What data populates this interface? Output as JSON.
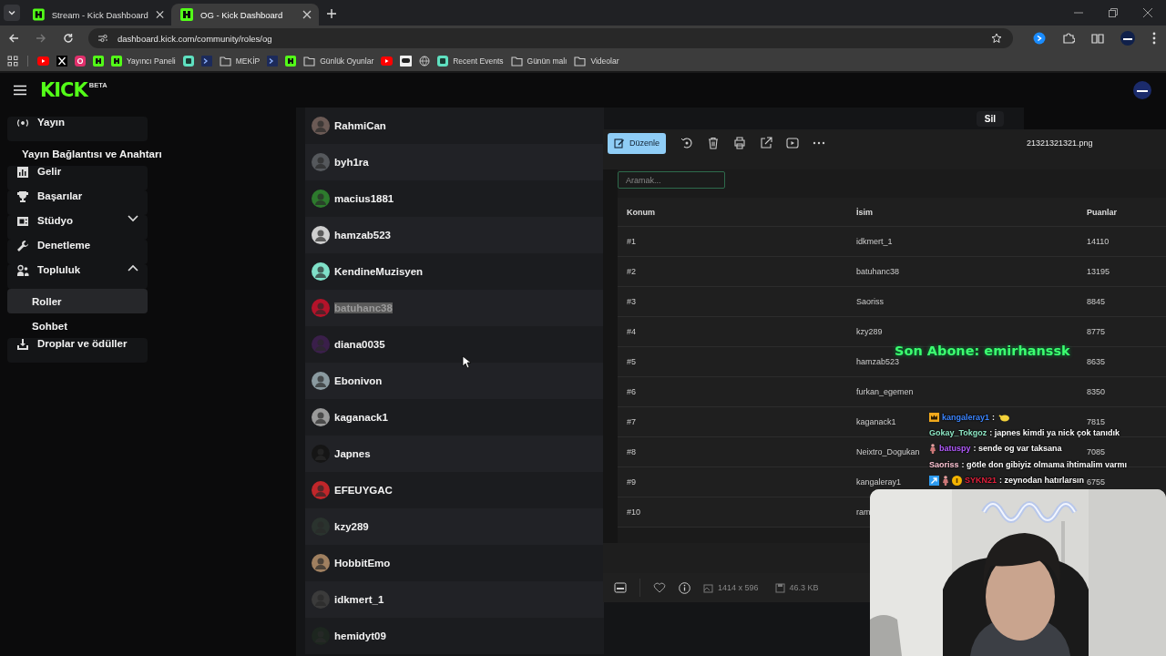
{
  "browser": {
    "tabs": [
      {
        "title": "Stream - Kick Dashboard",
        "selected": false
      },
      {
        "title": "OG - Kick Dashboard",
        "selected": true
      }
    ],
    "url": "dashboard.kick.com/community/roles/og",
    "bookmarks": [
      {
        "kind": "youtube"
      },
      {
        "kind": "x"
      },
      {
        "kind": "instagram"
      },
      {
        "kind": "kick"
      },
      {
        "kind": "kick",
        "label": "Yayıncı Paneli"
      },
      {
        "kind": "app"
      },
      {
        "kind": "terminal"
      },
      {
        "kind": "folder",
        "label": "MEKİP"
      },
      {
        "kind": "terminal"
      },
      {
        "kind": "kick"
      },
      {
        "kind": "folder",
        "label": "Günlük Oyunlar"
      },
      {
        "kind": "youtube"
      },
      {
        "kind": "game"
      },
      {
        "kind": "globe"
      },
      {
        "kind": "app",
        "label": "Recent Events"
      },
      {
        "kind": "folder",
        "label": "Günün malı"
      },
      {
        "kind": "folder",
        "label": "Videolar"
      }
    ]
  },
  "header": {
    "logo": "KICK",
    "logo_badge": "BETA"
  },
  "sidebar": {
    "items": [
      {
        "kind": "main",
        "label": "Yayın",
        "selected": false
      },
      {
        "kind": "link",
        "label": "Yayın Bağlantısı ve Anahtarı",
        "selected": false
      },
      {
        "kind": "main",
        "label": "Gelir",
        "selected": false
      },
      {
        "kind": "main",
        "label": "Başarılar",
        "selected": false
      },
      {
        "kind": "main",
        "label": "Stüdyo",
        "expanded": false,
        "selected": false
      },
      {
        "kind": "main",
        "label": "Denetleme",
        "selected": false
      },
      {
        "kind": "main",
        "label": "Topluluk",
        "expanded": true,
        "selected": false
      },
      {
        "kind": "sub",
        "label": "Roller",
        "selected": true
      },
      {
        "kind": "sub",
        "label": "Sohbet",
        "selected": false
      },
      {
        "kind": "main",
        "label": "Droplar ve ödüller",
        "selected": false
      }
    ]
  },
  "members": [
    {
      "name": "RahmiCan",
      "text_selected": false
    },
    {
      "name": "byh1ra",
      "text_selected": false
    },
    {
      "name": "macius1881",
      "text_selected": false
    },
    {
      "name": "hamzab523",
      "text_selected": false
    },
    {
      "name": "KendineMuzisyen",
      "text_selected": false
    },
    {
      "name": "batuhanc38",
      "text_selected": true
    },
    {
      "name": "diana0035",
      "text_selected": false
    },
    {
      "name": "Ebonivon",
      "text_selected": false
    },
    {
      "name": "kaganack1",
      "text_selected": false
    },
    {
      "name": "Japnes",
      "text_selected": false
    },
    {
      "name": "EFEUYGAC",
      "text_selected": false
    },
    {
      "name": "kzy289",
      "text_selected": false
    },
    {
      "name": "HobbitEmo",
      "text_selected": false
    },
    {
      "name": "idkmert_1",
      "text_selected": false
    },
    {
      "name": "hemidyt09",
      "text_selected": false
    }
  ],
  "delete_button": "Sil",
  "viewer": {
    "edit_button": "Düzenle",
    "filename": "21321321321.png",
    "image": {
      "search_placeholder": "Aramak...",
      "columns": [
        "Konum",
        "İsim",
        "Puanlar"
      ],
      "rows": [
        [
          "#1",
          "idkmert_1",
          "14110"
        ],
        [
          "#2",
          "batuhanc38",
          "13195"
        ],
        [
          "#3",
          "Saoriss",
          "8845"
        ],
        [
          "#4",
          "kzy289",
          "8775"
        ],
        [
          "#5",
          "hamzab523",
          "8635"
        ],
        [
          "#6",
          "furkan_egemen",
          "8350"
        ],
        [
          "#7",
          "kaganack1",
          "7815"
        ],
        [
          "#8",
          "Neixtro_Dogukan",
          "7085"
        ],
        [
          "#9",
          "kangaleray1",
          "6755"
        ],
        [
          "#10",
          "ram"
        ]
      ]
    },
    "dimensions": "1414 x 596",
    "file_size": "46.3 KB"
  },
  "overlay": {
    "latest_sub": "Son Abone: emirhanssk",
    "chat": [
      {
        "badges": [
          {
            "kind": "crown"
          }
        ],
        "user": "kangaleray1",
        "color": "#3d86ff",
        "message": ":",
        "emote": true
      },
      {
        "user": "Gokay_Tokgoz",
        "color": "#8ee6c4",
        "message": ": japnes kimdi ya nick çok tanıdık"
      },
      {
        "badges": [
          {
            "kind": "figure"
          }
        ],
        "user": "batuspy",
        "color": "#b45cff",
        "message": ": sende og var taksana"
      },
      {
        "user": "Saoriss",
        "color": "#ffc6d6",
        "message": ": götle don gibiyiz olmama ihtimalim varmı"
      },
      {
        "badges": [
          {
            "kind": "arrow"
          },
          {
            "kind": "figure"
          },
          {
            "kind": "coin"
          }
        ],
        "user": "SYKN21",
        "color": "#e2203c",
        "message": ": zeynodan hatırlarsın"
      }
    ]
  }
}
